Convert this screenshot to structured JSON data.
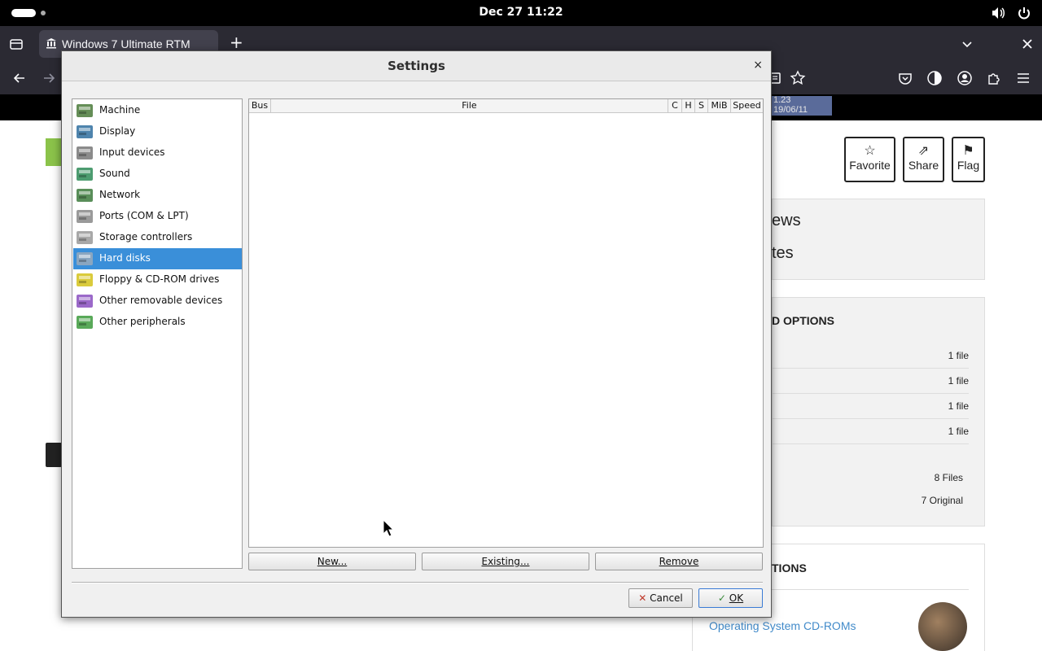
{
  "topbar": {
    "clock": "Dec 27  11:22"
  },
  "browser": {
    "tab_title": "Windows 7 Ultimate RTM",
    "new_tab": "+"
  },
  "page": {
    "strip_tile_line1": "1.23",
    "strip_tile_line2": "19/06/11",
    "favorite_label": "Favorite",
    "share_label": "Share",
    "flag_label": "Flag",
    "panel1_line1": "ews",
    "panel1_line2": "tes",
    "options_heading": "D OPTIONS",
    "file_rows": [
      "1 file",
      "1 file",
      "1 file",
      "1 file"
    ],
    "files_total": "8 Files",
    "original_total": "7 Original",
    "collections_heading": "TIONS",
    "collection_link": "Operating System CD-ROMs"
  },
  "dialog": {
    "title": "Settings",
    "close": "×",
    "sidebar": [
      {
        "label": "Machine",
        "icon": "machine-icon",
        "color": "#4a7a3a"
      },
      {
        "label": "Display",
        "icon": "display-icon",
        "color": "#2f6f9f"
      },
      {
        "label": "Input devices",
        "icon": "input-devices-icon",
        "color": "#777777"
      },
      {
        "label": "Sound",
        "icon": "sound-icon",
        "color": "#2e8b57"
      },
      {
        "label": "Network",
        "icon": "network-icon",
        "color": "#3c7a3c"
      },
      {
        "label": "Ports (COM & LPT)",
        "icon": "ports-icon",
        "color": "#888888"
      },
      {
        "label": "Storage controllers",
        "icon": "storage-controllers-icon",
        "color": "#999999"
      },
      {
        "label": "Hard disks",
        "icon": "hard-disks-icon",
        "color": "#9ab"
      },
      {
        "label": "Floppy & CD-ROM drives",
        "icon": "floppy-cdrom-icon",
        "color": "#d4c21a"
      },
      {
        "label": "Other removable devices",
        "icon": "removable-devices-icon",
        "color": "#8a4fbf"
      },
      {
        "label": "Other peripherals",
        "icon": "peripherals-icon",
        "color": "#3c9a3c"
      }
    ],
    "selected_index": 7,
    "columns": [
      "Bus",
      "File",
      "C",
      "H",
      "S",
      "MiB",
      "Speed"
    ],
    "buttons": {
      "new": "New...",
      "existing": "Existing...",
      "remove": "Remove",
      "cancel": "Cancel",
      "ok": "OK"
    }
  }
}
